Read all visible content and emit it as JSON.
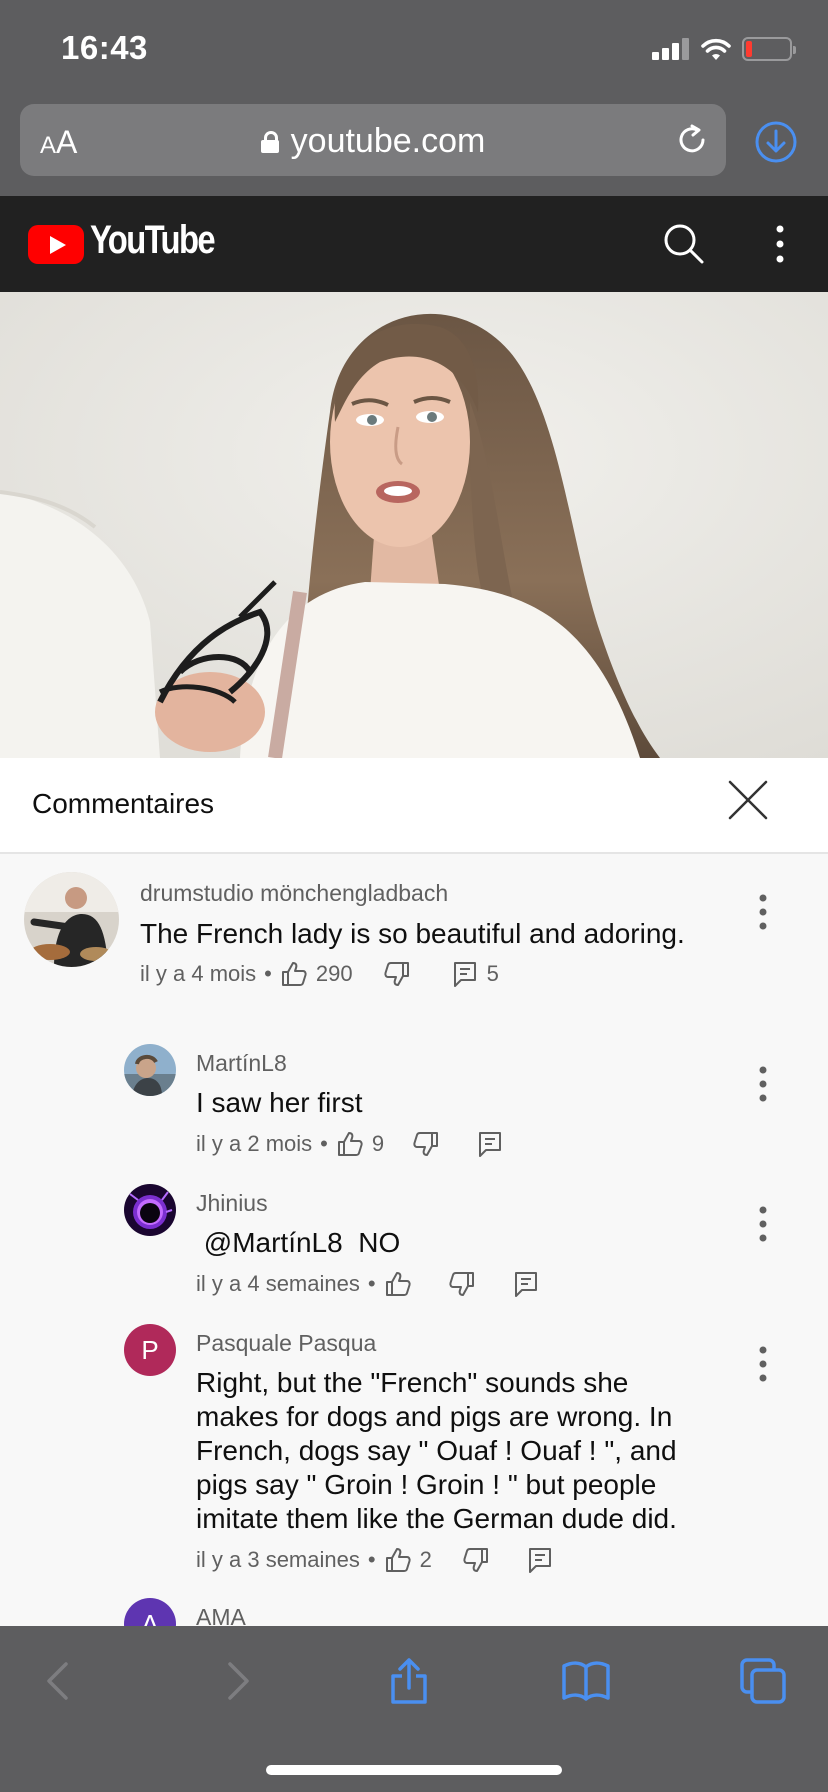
{
  "status_bar": {
    "time": "16:43"
  },
  "browser": {
    "text_size_small": "A",
    "text_size_large": "A",
    "url": "youtube.com",
    "colors": {
      "chrome": "#5d5d5f",
      "accent": "#4a8ff0"
    }
  },
  "youtube": {
    "wordmark": "YouTube",
    "colors": {
      "header": "#212121",
      "brand": "#ff0000"
    }
  },
  "comments_panel": {
    "title": "Commentaires",
    "comments": [
      {
        "author": "drumstudio mönchengladbach",
        "text": "The French lady is so beautiful and adoring.",
        "time": "il y a 4 mois",
        "likes": "290",
        "replies": "5"
      },
      {
        "author": "MartínL8",
        "text": "I saw her first",
        "time": "il y a 2 mois",
        "likes": "9"
      },
      {
        "author": "Jhinius",
        "text": " @MartínL8  NO",
        "time": "il y a 4 semaines",
        "likes": ""
      },
      {
        "author": "Pasquale Pasqua",
        "avatar_letter": "P",
        "avatar_color": "#b0295a",
        "text": "Right, but the \"French\" sounds she makes for dogs and pigs are wrong. In French, dogs say \" Ouaf ! Ouaf ! \", and pigs say \" Groin ! Groin ! \" but people imitate them like the German dude did.",
        "time": "il y a 3 semaines",
        "likes": "2"
      },
      {
        "author": "AMA",
        "avatar_letter": "A",
        "avatar_color": "#5e35b1"
      }
    ]
  },
  "meta_separator": "•"
}
